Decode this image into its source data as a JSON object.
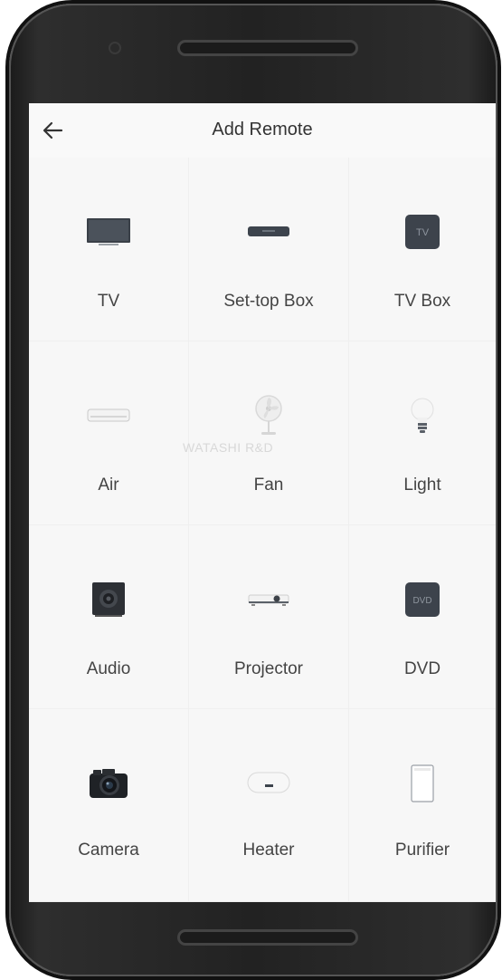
{
  "header": {
    "title": "Add Remote",
    "back_icon": "arrow-left-icon"
  },
  "watermark": "WATASHI R&D",
  "devices": [
    {
      "label": "TV",
      "icon": "tv-icon"
    },
    {
      "label": "Set-top Box",
      "icon": "set-top-box-icon"
    },
    {
      "label": "TV Box",
      "icon": "tv-box-icon",
      "icon_text": "TV"
    },
    {
      "label": "Air",
      "icon": "air-conditioner-icon"
    },
    {
      "label": "Fan",
      "icon": "fan-icon"
    },
    {
      "label": "Light",
      "icon": "light-bulb-icon"
    },
    {
      "label": "Audio",
      "icon": "speaker-icon"
    },
    {
      "label": "Projector",
      "icon": "projector-icon"
    },
    {
      "label": "DVD",
      "icon": "dvd-icon",
      "icon_text": "DVD"
    },
    {
      "label": "Camera",
      "icon": "camera-icon"
    },
    {
      "label": "Heater",
      "icon": "water-heater-icon"
    },
    {
      "label": "Purifier",
      "icon": "air-purifier-icon"
    }
  ]
}
